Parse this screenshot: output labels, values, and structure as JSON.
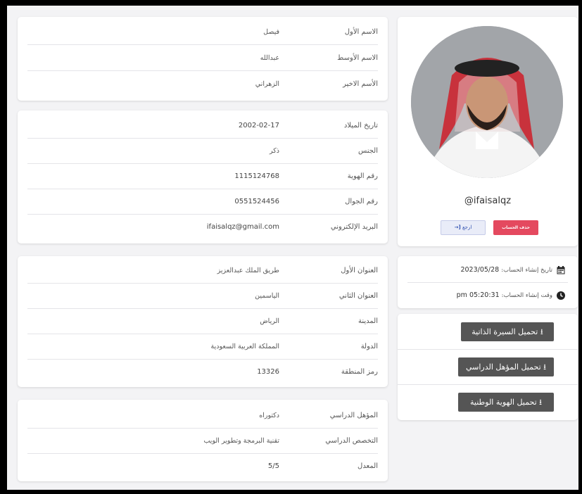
{
  "names": [
    {
      "label": "الاسم الأول",
      "value": "فيصل"
    },
    {
      "label": "الاسم الأوسط",
      "value": "عبدالله"
    },
    {
      "label": "الأسم الاخير",
      "value": "الزهراني"
    }
  ],
  "personal": [
    {
      "label": "تاريخ الميلاد",
      "value": "2002-02-17"
    },
    {
      "label": "الجنس",
      "value": "ذكر"
    },
    {
      "label": "رقم الهوية",
      "value": "1115124768"
    },
    {
      "label": "رقم الجوال",
      "value": "0551524456"
    },
    {
      "label": "البريد الإلكتروني",
      "value": "ifaisalqz@gmail.com"
    }
  ],
  "address": [
    {
      "label": "العنوان الأول",
      "value": "طريق الملك عبدالعزيز"
    },
    {
      "label": "العنوان الثاني",
      "value": "الياسمين"
    },
    {
      "label": "المدينة",
      "value": "الرياض"
    },
    {
      "label": "الدولة",
      "value": "المملكة العربية السعودية"
    },
    {
      "label": "رمز المنطقة",
      "value": "13326"
    }
  ],
  "education": [
    {
      "label": "المؤهل الدراسي",
      "value": "دكتوراه"
    },
    {
      "label": "التخصص الدراسي",
      "value": "تقنية البرمجة وتطوير الويب"
    },
    {
      "label": "المعدل",
      "value": "5/5"
    }
  ],
  "profile": {
    "username": "@ifaisalqz",
    "delete_label": "حذف الحساب",
    "back_label": "ارجع",
    "back_icon": "sign-in-icon"
  },
  "account": {
    "created_date_label": "تاريخ إنشاء الحساب:",
    "created_date_value": "2023/05/28",
    "created_time_label": "وقت إنشاء الحساب:",
    "created_time_value": "05:20:31 pm",
    "calendar_icon": "calendar-icon",
    "clock_icon": "clock-icon"
  },
  "downloads": [
    {
      "label": "تحميل السيرة الذاتية",
      "icon": "download-icon"
    },
    {
      "label": "تحميل المؤهل الدراسي",
      "icon": "download-icon"
    },
    {
      "label": "تحميل الهوية الوطنية",
      "icon": "download-icon"
    }
  ],
  "colors": {
    "delete": "#e4495f",
    "download": "#555555",
    "background": "#f3f3f5"
  }
}
